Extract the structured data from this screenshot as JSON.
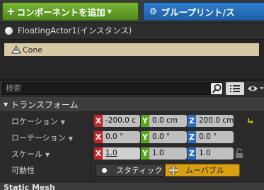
{
  "toolbar": {
    "add_component_label": "コンポーネントを追加",
    "blueprint_label": "ブループリント/ス"
  },
  "actor": {
    "name": "FloatingActor1(インスタンス)"
  },
  "component_tree": {
    "items": [
      {
        "label": "Cone"
      }
    ]
  },
  "search": {
    "placeholder": "検索"
  },
  "transform": {
    "section_title": "トランスフォーム",
    "location": {
      "label": "ロケーション",
      "x": "-200.0 c",
      "y": "0.0 cm",
      "z": "200.0 cm"
    },
    "rotation": {
      "label": "ローテーション",
      "x": "0.0 °",
      "y": "0.0 °",
      "z": "0.0 °"
    },
    "scale": {
      "label": "スケール",
      "x": "1.0",
      "y": "1.0",
      "z": "1.0"
    },
    "mobility": {
      "label": "可動性",
      "static_label": "スタティック",
      "movable_label": "ムーバブル",
      "selected": "movable"
    },
    "axis_labels": {
      "x": "X",
      "y": "Y",
      "z": "Z"
    }
  },
  "static_mesh": {
    "section_title": "Static Mesh"
  },
  "colors": {
    "add_button": "#5f9e26",
    "blueprint_button": "#2772c0",
    "selection": "#d6c9a4",
    "x_axis": "#c42424",
    "y_axis": "#55a61b",
    "z_axis": "#2b6ac4",
    "movable": "#d9a012"
  },
  "icons": [
    "plus-icon",
    "gear-icon",
    "actor-sphere-icon",
    "cone-mesh-icon",
    "search-icon",
    "grid-view-icon",
    "eye-icon",
    "reset-arrow-icon",
    "lock-icon",
    "move-arrows-icon"
  ]
}
